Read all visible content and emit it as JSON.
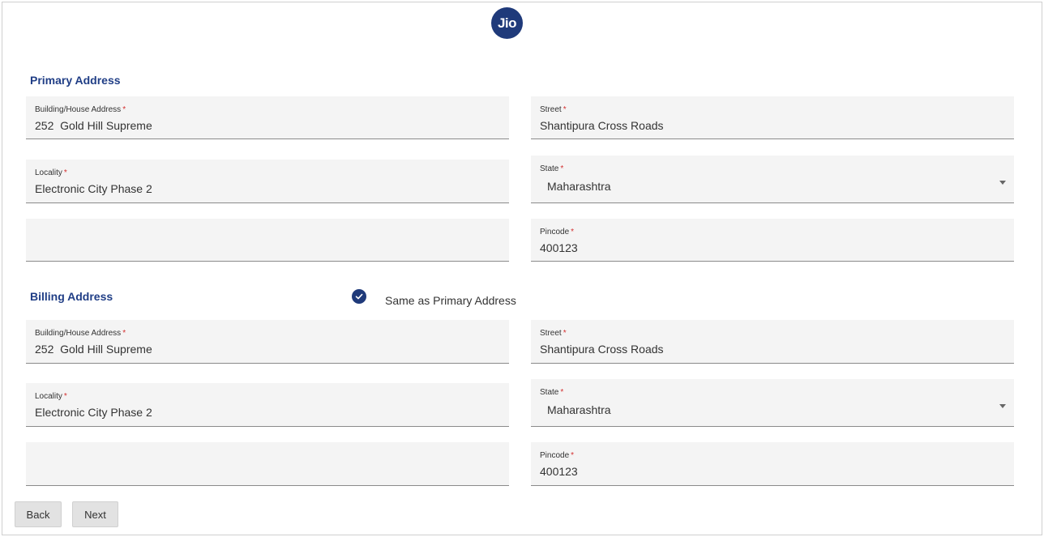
{
  "logo": {
    "text": "Jio"
  },
  "primary": {
    "title": "Primary Address",
    "building": {
      "label": "Building/House Address",
      "value": "252  Gold Hill Supreme"
    },
    "street": {
      "label": "Street",
      "value": "Shantipura Cross Roads"
    },
    "locality": {
      "label": "Locality",
      "value": "Electronic City Phase 2"
    },
    "state": {
      "label": "State",
      "value": "Maharashtra"
    },
    "pincode": {
      "label": "Pincode",
      "value": "400123"
    }
  },
  "billing": {
    "title": "Billing Address",
    "same_as_primary": {
      "label": "Same as Primary Address",
      "checked": true
    },
    "building": {
      "label": "Building/House Address",
      "value": "252  Gold Hill Supreme"
    },
    "street": {
      "label": "Street",
      "value": "Shantipura Cross Roads"
    },
    "locality": {
      "label": "Locality",
      "value": "Electronic City Phase 2"
    },
    "state": {
      "label": "State",
      "value": "Maharashtra"
    },
    "pincode": {
      "label": "Pincode",
      "value": "400123"
    }
  },
  "required_marker": "*",
  "buttons": {
    "back": "Back",
    "next": "Next"
  },
  "colors": {
    "brand": "#1f3a7a",
    "title": "#203e86",
    "required": "#d32f2f"
  },
  "icons": {
    "dropdown": "chevron-down-icon",
    "checkbox": "check-icon"
  }
}
